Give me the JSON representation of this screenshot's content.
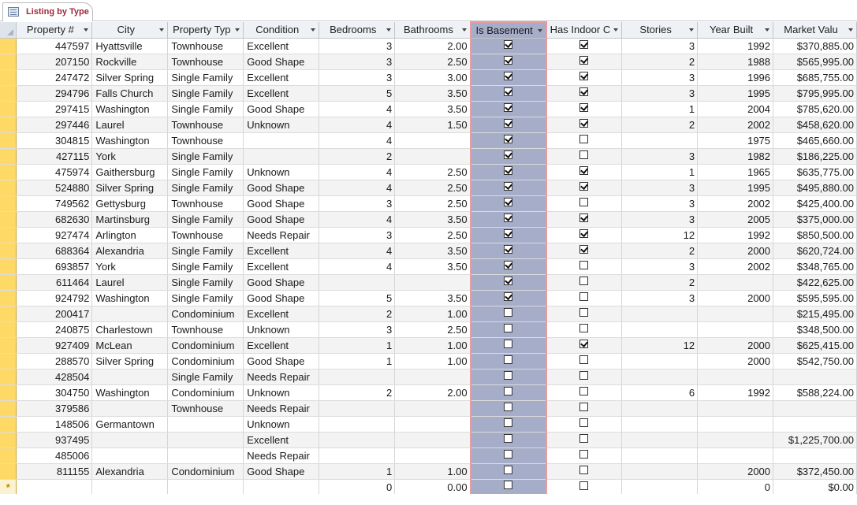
{
  "tab": {
    "label": "Listing by Type"
  },
  "columns": [
    {
      "key": "property",
      "label": "Property #"
    },
    {
      "key": "city",
      "label": "City"
    },
    {
      "key": "type",
      "label": "Property Typ"
    },
    {
      "key": "condition",
      "label": "Condition"
    },
    {
      "key": "bedrooms",
      "label": "Bedrooms"
    },
    {
      "key": "bathrooms",
      "label": "Bathrooms"
    },
    {
      "key": "basement",
      "label": "Is Basement"
    },
    {
      "key": "pool",
      "label": "Has Indoor C"
    },
    {
      "key": "stories",
      "label": "Stories"
    },
    {
      "key": "year",
      "label": "Year Built"
    },
    {
      "key": "value",
      "label": "Market Valu"
    }
  ],
  "rows": [
    [
      "447597",
      "Hyattsville",
      "Townhouse",
      "Excellent",
      "3",
      "2.00",
      true,
      true,
      "3",
      "1992",
      "$370,885.00"
    ],
    [
      "207150",
      "Rockville",
      "Townhouse",
      "Good Shape",
      "3",
      "2.50",
      true,
      true,
      "2",
      "1988",
      "$565,995.00"
    ],
    [
      "247472",
      "Silver Spring",
      "Single Family",
      "Excellent",
      "3",
      "3.00",
      true,
      true,
      "3",
      "1996",
      "$685,755.00"
    ],
    [
      "294796",
      "Falls Church",
      "Single Family",
      "Excellent",
      "5",
      "3.50",
      true,
      true,
      "3",
      "1995",
      "$795,995.00"
    ],
    [
      "297415",
      "Washington",
      "Single Family",
      "Good Shape",
      "4",
      "3.50",
      true,
      true,
      "1",
      "2004",
      "$785,620.00"
    ],
    [
      "297446",
      "Laurel",
      "Townhouse",
      "Unknown",
      "4",
      "1.50",
      true,
      true,
      "2",
      "2002",
      "$458,620.00"
    ],
    [
      "304815",
      "Washington",
      "Townhouse",
      "",
      "4",
      "",
      true,
      false,
      "",
      "1975",
      "$465,660.00"
    ],
    [
      "427115",
      "York",
      "Single Family",
      "",
      "2",
      "",
      true,
      false,
      "3",
      "1982",
      "$186,225.00"
    ],
    [
      "475974",
      "Gaithersburg",
      "Single Family",
      "Unknown",
      "4",
      "2.50",
      true,
      true,
      "1",
      "1965",
      "$635,775.00"
    ],
    [
      "524880",
      "Silver Spring",
      "Single Family",
      "Good Shape",
      "4",
      "2.50",
      true,
      true,
      "3",
      "1995",
      "$495,880.00"
    ],
    [
      "749562",
      "Gettysburg",
      "Townhouse",
      "Good Shape",
      "3",
      "2.50",
      true,
      false,
      "3",
      "2002",
      "$425,400.00"
    ],
    [
      "682630",
      "Martinsburg",
      "Single Family",
      "Good Shape",
      "4",
      "3.50",
      true,
      true,
      "3",
      "2005",
      "$375,000.00"
    ],
    [
      "927474",
      "Arlington",
      "Townhouse",
      "Needs Repair",
      "3",
      "2.50",
      true,
      true,
      "12",
      "1992",
      "$850,500.00"
    ],
    [
      "688364",
      "Alexandria",
      "Single Family",
      "Excellent",
      "4",
      "3.50",
      true,
      true,
      "2",
      "2000",
      "$620,724.00"
    ],
    [
      "693857",
      "York",
      "Single Family",
      "Excellent",
      "4",
      "3.50",
      true,
      false,
      "3",
      "2002",
      "$348,765.00"
    ],
    [
      "611464",
      "Laurel",
      "Single Family",
      "Good Shape",
      "",
      "",
      true,
      false,
      "2",
      "",
      "$422,625.00"
    ],
    [
      "924792",
      "Washington",
      "Single Family",
      "Good Shape",
      "5",
      "3.50",
      true,
      false,
      "3",
      "2000",
      "$595,595.00"
    ],
    [
      "200417",
      "",
      "Condominium",
      "Excellent",
      "2",
      "1.00",
      false,
      false,
      "",
      "",
      "$215,495.00"
    ],
    [
      "240875",
      "Charlestown",
      "Townhouse",
      "Unknown",
      "3",
      "2.50",
      false,
      false,
      "",
      "",
      "$348,500.00"
    ],
    [
      "927409",
      "McLean",
      "Condominium",
      "Excellent",
      "1",
      "1.00",
      false,
      true,
      "12",
      "2000",
      "$625,415.00"
    ],
    [
      "288570",
      "Silver Spring",
      "Condominium",
      "Good Shape",
      "1",
      "1.00",
      false,
      false,
      "",
      "2000",
      "$542,750.00"
    ],
    [
      "428504",
      "",
      "Single Family",
      "Needs Repair",
      "",
      "",
      false,
      false,
      "",
      "",
      ""
    ],
    [
      "304750",
      "Washington",
      "Condominium",
      "Unknown",
      "2",
      "2.00",
      false,
      false,
      "6",
      "1992",
      "$588,224.00"
    ],
    [
      "379586",
      "",
      "Townhouse",
      "Needs Repair",
      "",
      "",
      false,
      false,
      "",
      "",
      ""
    ],
    [
      "148506",
      "Germantown",
      "",
      "Unknown",
      "",
      "",
      false,
      false,
      "",
      "",
      ""
    ],
    [
      "937495",
      "",
      "",
      "Excellent",
      "",
      "",
      false,
      false,
      "",
      "",
      "$1,225,700.00"
    ],
    [
      "485006",
      "",
      "",
      "Needs Repair",
      "",
      "",
      false,
      false,
      "",
      "",
      ""
    ],
    [
      "811155",
      "Alexandria",
      "Condominium",
      "Good Shape",
      "1",
      "1.00",
      false,
      false,
      "",
      "2000",
      "$372,450.00"
    ]
  ],
  "new_row": {
    "marker": "*",
    "bedrooms": "0",
    "bathrooms": "0.00",
    "basement": false,
    "pool": false,
    "year": "0",
    "value": "$0.00"
  },
  "selected_column": "basement"
}
